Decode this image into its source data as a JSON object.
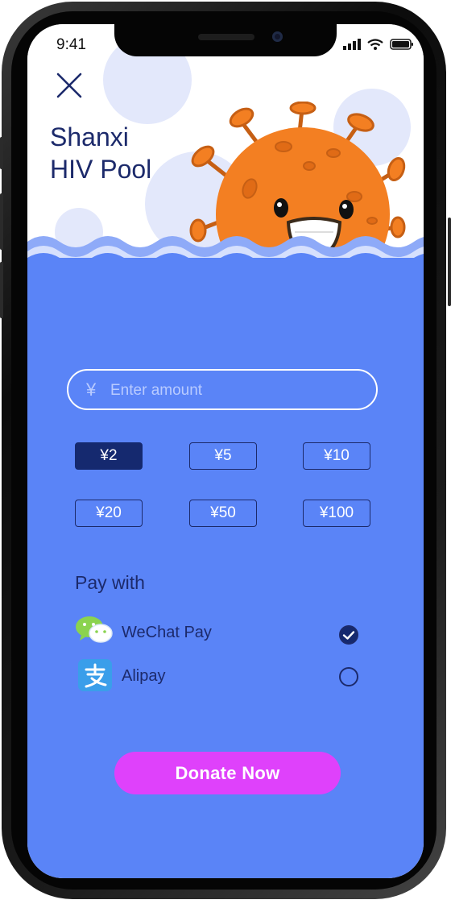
{
  "status_bar": {
    "time": "9:41"
  },
  "header": {
    "title_line1": "Shanxi",
    "title_line2": "HIV Pool"
  },
  "amount_input": {
    "currency_symbol": "¥",
    "placeholder": "Enter amount",
    "value": ""
  },
  "amount_options": [
    {
      "label": "¥2",
      "selected": true
    },
    {
      "label": "¥5",
      "selected": false
    },
    {
      "label": "¥10",
      "selected": false
    },
    {
      "label": "¥20",
      "selected": false
    },
    {
      "label": "¥50",
      "selected": false
    },
    {
      "label": "¥100",
      "selected": false
    }
  ],
  "payment": {
    "heading": "Pay with",
    "methods": [
      {
        "label": "WeChat Pay",
        "icon": "wechat-icon",
        "checked": true
      },
      {
        "label": "Alipay",
        "icon": "alipay-icon",
        "checked": false
      }
    ]
  },
  "donate_label": "Donate Now",
  "colors": {
    "background_blue": "#5a84f7",
    "navy": "#1c2a6b",
    "selected_chip": "#15296f",
    "donate_button": "#df41fb",
    "virus_orange": "#f37f22"
  }
}
